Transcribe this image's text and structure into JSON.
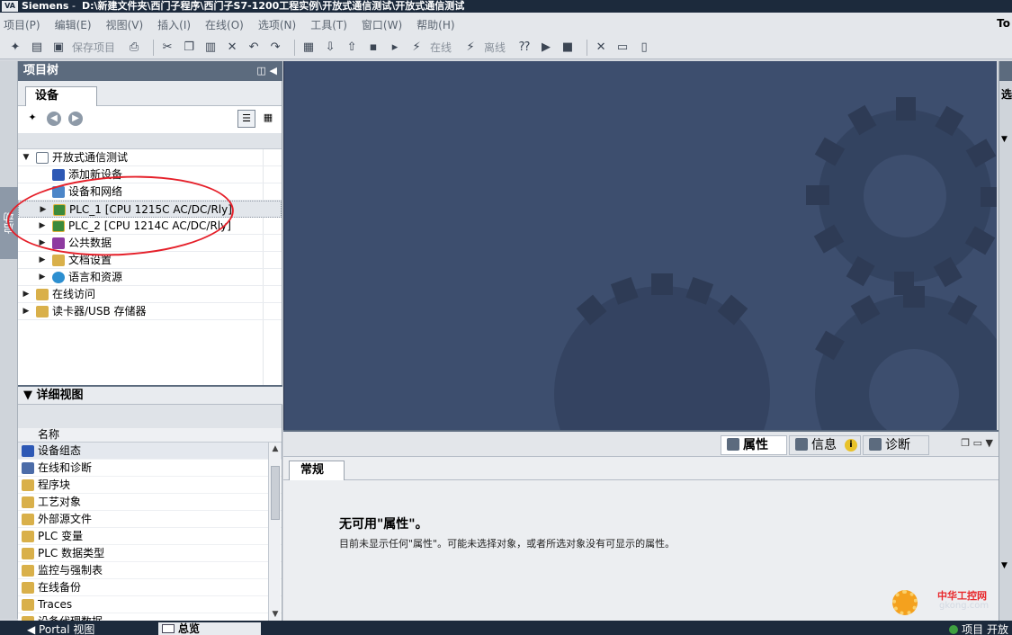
{
  "title": {
    "app": "Siemens",
    "path": "D:\\新建文件夹\\西门子程序\\西门子S7-1200工程实例\\开放式通信测试\\开放式通信测试"
  },
  "menu": [
    "项目(P)",
    "编辑(E)",
    "视图(V)",
    "插入(I)",
    "在线(O)",
    "选项(N)",
    "工具(T)",
    "窗口(W)",
    "帮助(H)"
  ],
  "menu_right": "To",
  "toolbar": {
    "save_project": "保存项目",
    "go_online": "在线",
    "go_offline": "离线"
  },
  "left_tab": "启动",
  "project_tree": {
    "title": "项目树",
    "tab": "设备",
    "items": [
      {
        "label": "开放式通信测试"
      },
      {
        "label": "添加新设备"
      },
      {
        "label": "设备和网络"
      },
      {
        "label": "PLC_1 [CPU 1215C AC/DC/Rly]"
      },
      {
        "label": "PLC_2 [CPU 1214C AC/DC/Rly]"
      },
      {
        "label": "公共数据"
      },
      {
        "label": "文档设置"
      },
      {
        "label": "语言和资源"
      },
      {
        "label": "在线访问"
      },
      {
        "label": "读卡器/USB 存储器"
      }
    ]
  },
  "detail_view": {
    "title": "详细视图",
    "column": "名称",
    "items": [
      "设备组态",
      "在线和诊断",
      "程序块",
      "工艺对象",
      "外部源文件",
      "PLC 变量",
      "PLC 数据类型",
      "监控与强制表",
      "在线备份",
      "Traces",
      "设备代理数据"
    ]
  },
  "inspector": {
    "tabs": [
      "属性",
      "信息",
      "诊断"
    ],
    "sub_tab": "常规",
    "message_title": "无可用\"属性\"。",
    "message_text": "目前未显示任何\"属性\"。可能未选择对象，或者所选对象没有可显示的属性。"
  },
  "right_strip_label": "选",
  "status": {
    "portal": "Portal 视图",
    "overview": "总览",
    "project_status": "项目 开放"
  },
  "watermark": {
    "name": "中华工控网",
    "url": "gkong.com"
  },
  "icons": {
    "expand": "triangle-right-icon",
    "collapse": "triangle-down-icon"
  },
  "colors": {
    "workspace_bg": "#3d4e6e",
    "header_bg": "#5c6b7e",
    "annotation_red": "#e5202a"
  }
}
